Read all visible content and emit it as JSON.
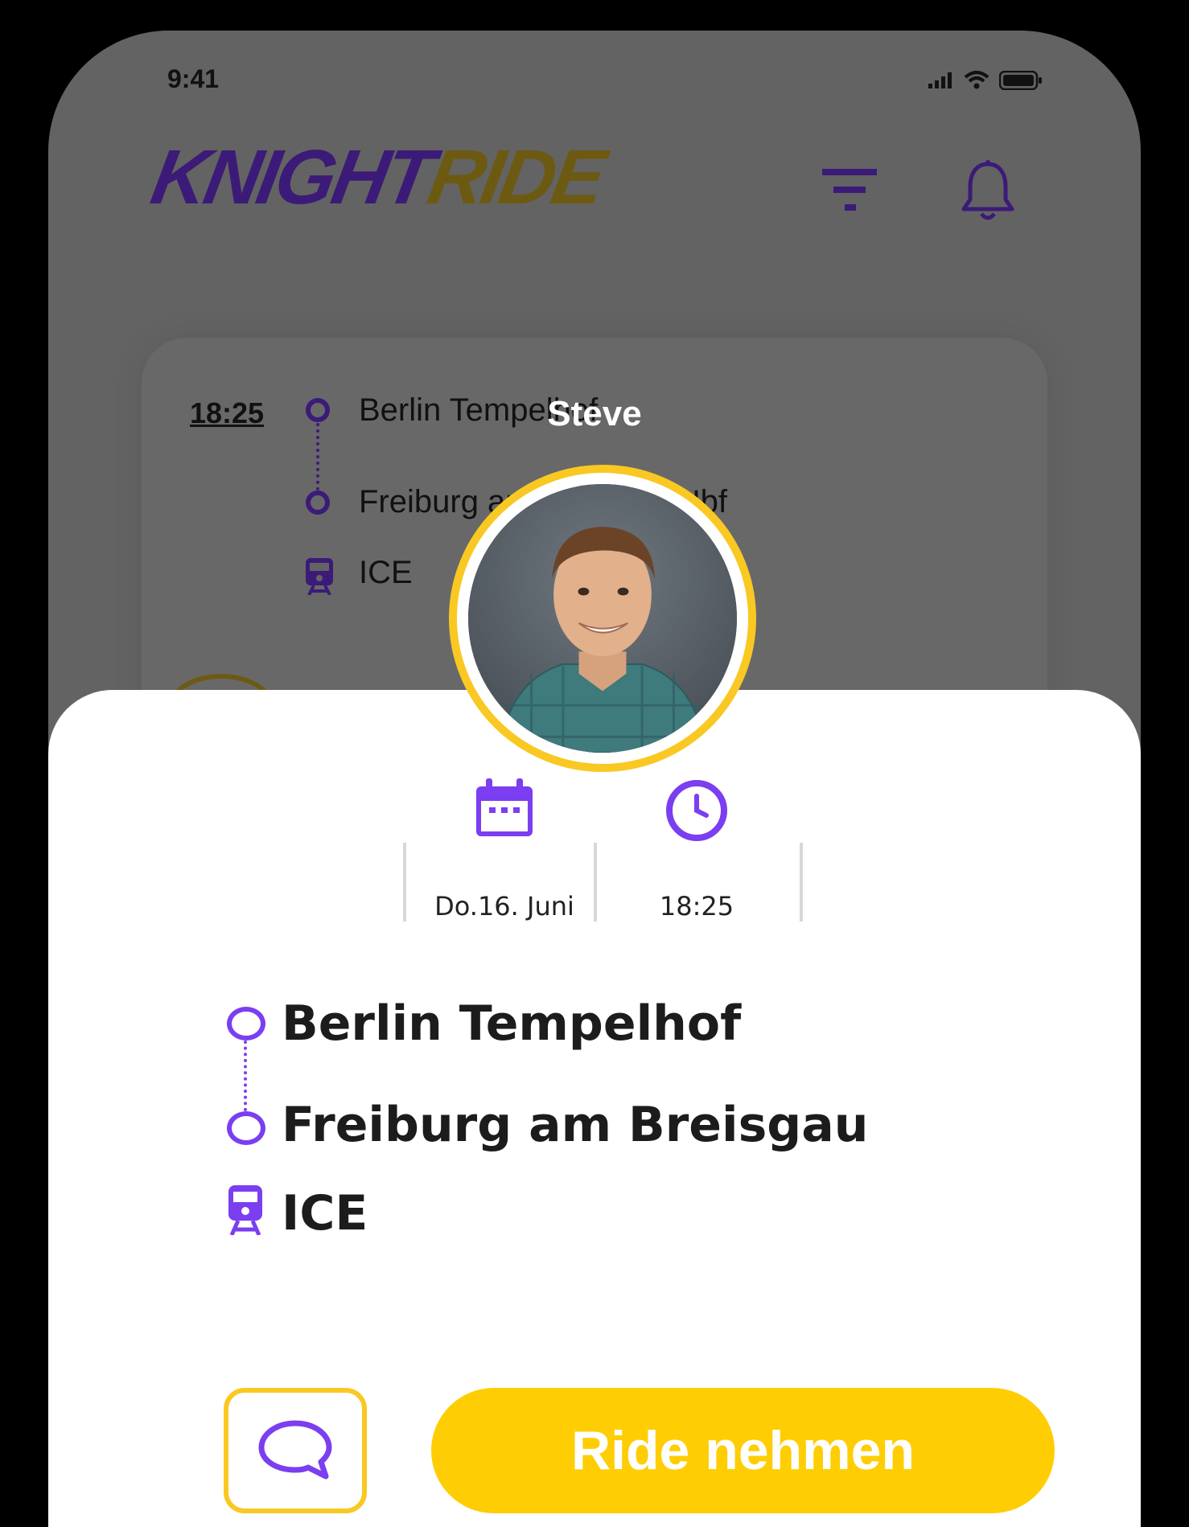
{
  "status_bar": {
    "time": "9:41"
  },
  "header": {
    "logo_part1": "KNIGHT",
    "logo_part2": "RIDE"
  },
  "background_card": {
    "time": "18:25",
    "from": "Berlin Tempelhof",
    "to": "Freiburg am Breisgau Hbf",
    "transport": "ICE"
  },
  "driver": {
    "name": "Steve"
  },
  "details": {
    "date": "Do.16. Juni",
    "time": "18:25",
    "from": "Berlin Tempelhof",
    "to": "Freiburg am Breisgau",
    "transport": "ICE"
  },
  "actions": {
    "primary_label": "Ride nehmen"
  },
  "colors": {
    "accent_purple": "#7b3ef0",
    "dark_purple": "#3b1b77",
    "yellow": "#ffcd03",
    "ring_yellow": "#f9c823"
  },
  "icons": [
    "signal-icon",
    "wifi-icon",
    "battery-icon",
    "filter-icon",
    "bell-icon",
    "train-icon",
    "calendar-icon",
    "clock-icon",
    "chat-icon"
  ]
}
